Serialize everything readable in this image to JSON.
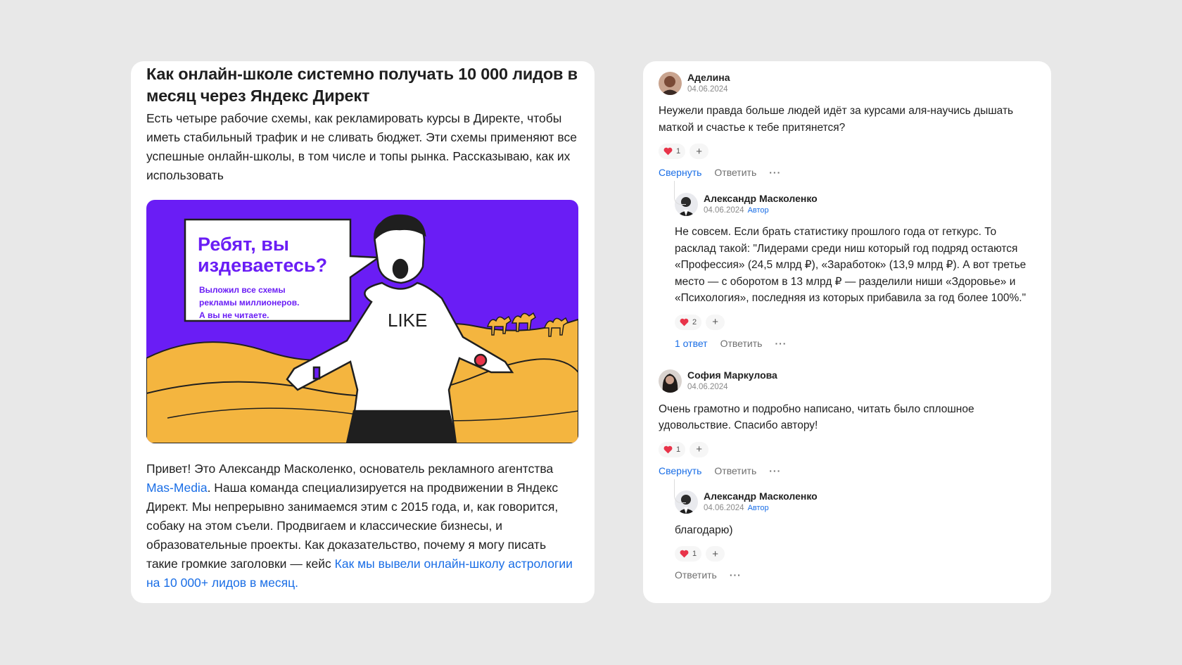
{
  "article": {
    "title": "Как онлайн-школе системно получать 10 000 лидов в месяц через Яндекс Директ",
    "lead": "Есть четыре рабочие схемы, как рекламировать курсы в Директе, чтобы иметь стабильный трафик и не сливать бюджет. Эти схемы применяют все успешные онлайн-школы, в том числе и топы рынка. Рассказываю, как их использовать",
    "hero": {
      "bubble_title_1": "Ребят, вы",
      "bubble_title_2": "издеваетесь?",
      "bubble_sub_1": "Выложил все схемы",
      "bubble_sub_2": "рекламы миллионеров.",
      "bubble_sub_3": "А вы не читаете.",
      "shirt_text": "LIKE",
      "colors": {
        "bg": "#6a1df5",
        "sand": "#f4b53f"
      }
    },
    "body_part1": "Привет! Это Александр Масколенко, основатель рекламного агентства ",
    "link_agency": "Mas-Media",
    "body_part2": ". Наша команда специализируется на продвижении в Яндекс Директ. Мы непрерывно занимаемся этим с 2015 года, и, как говорится, собаку на этом съели. Продвигаем и классические бизнесы, и образовательные проекты. Как доказательство, почему я могу писать такие громкие заголовки — кейс ",
    "link_case": "Как мы вывели онлайн-школу астрологии на 10 000+ лидов в месяц."
  },
  "comments": [
    {
      "name": "Аделина",
      "date": "04.06.2024",
      "text": "Неужели правда больше людей идёт за курсами аля-научись дышать маткой и счастье к тебе притянется?",
      "likes": "1",
      "collapse": "Свернуть",
      "reply_label": "Ответить",
      "reply": {
        "name": "Александр Масколенко",
        "date": "04.06.2024",
        "badge": "Автор",
        "text": "Не совсем. Если брать статистику прошлого года от геткурс. То расклад такой: \"Лидерами среди ниш который год подряд остаются «Профессия» (24,5 млрд ₽), «Заработок» (13,9 млрд ₽). А вот третье место — с оборотом в 13 млрд ₽ — разделили ниши «Здоровье» и «Психология», последняя из которых прибавила за год более 100%.\"",
        "likes": "2",
        "replies_count": "1 ответ",
        "reply_label": "Ответить"
      }
    },
    {
      "name": "София Маркулова",
      "date": "04.06.2024",
      "text": "Очень грамотно и подробно написано, читать было сплошное удовольствие. Спасибо автору!",
      "likes": "1",
      "collapse": "Свернуть",
      "reply_label": "Ответить",
      "reply": {
        "name": "Александр Масколенко",
        "date": "04.06.2024",
        "badge": "Автор",
        "text": "благодарю)",
        "likes": "1",
        "reply_label": "Ответить"
      }
    }
  ],
  "icons": {
    "heart": "heart-icon",
    "plus": "plus-icon",
    "more": "more-icon"
  },
  "colors": {
    "link": "#1a6ee6",
    "heart": "#e8344a"
  }
}
